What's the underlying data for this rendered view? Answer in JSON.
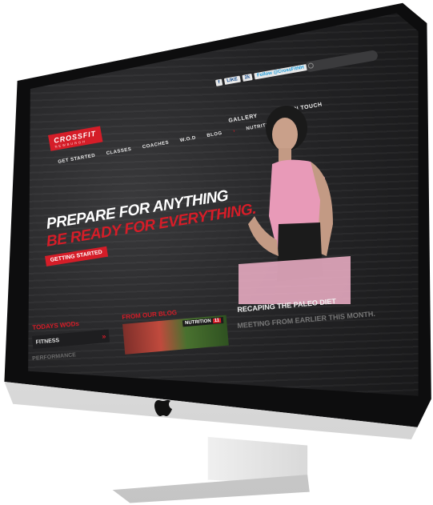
{
  "site": {
    "logo": {
      "main": "CROSSFIT",
      "sub": "NEWBURGH"
    },
    "social": [
      {
        "label": "f",
        "name": "facebook-icon"
      },
      {
        "label": "LIKE",
        "name": "like-button"
      },
      {
        "label": "2k",
        "name": "like-count"
      },
      {
        "label": "Follow @CrossFitNH",
        "name": "twitter-follow-button"
      }
    ],
    "top_nav": [
      "GALLERY",
      "GET IN TOUCH"
    ],
    "main_nav": [
      "GET STARTED",
      "CLASSES",
      "COACHES",
      "W.O.D",
      "BLOG",
      "NUTRITION"
    ],
    "hero": {
      "line1": "PREPARE FOR ANYTHING",
      "line2": "BE READY FOR EVERYTHING.",
      "cta": "GETTING STARTED"
    },
    "wods": {
      "heading": "TODAYS WODs",
      "items": [
        "FITNESS",
        "PERFORMANCE"
      ]
    },
    "blog": {
      "heading": "FROM OUR BLOG",
      "tag": "NUTRITION",
      "tag_count": "11",
      "post_title": "RECAPING THE PALEO DIET",
      "post_subtitle": "MEETING FROM EARLIER THIS MONTH."
    }
  },
  "colors": {
    "accent": "#d51d28",
    "screen_bg": "#1c1c1e"
  }
}
